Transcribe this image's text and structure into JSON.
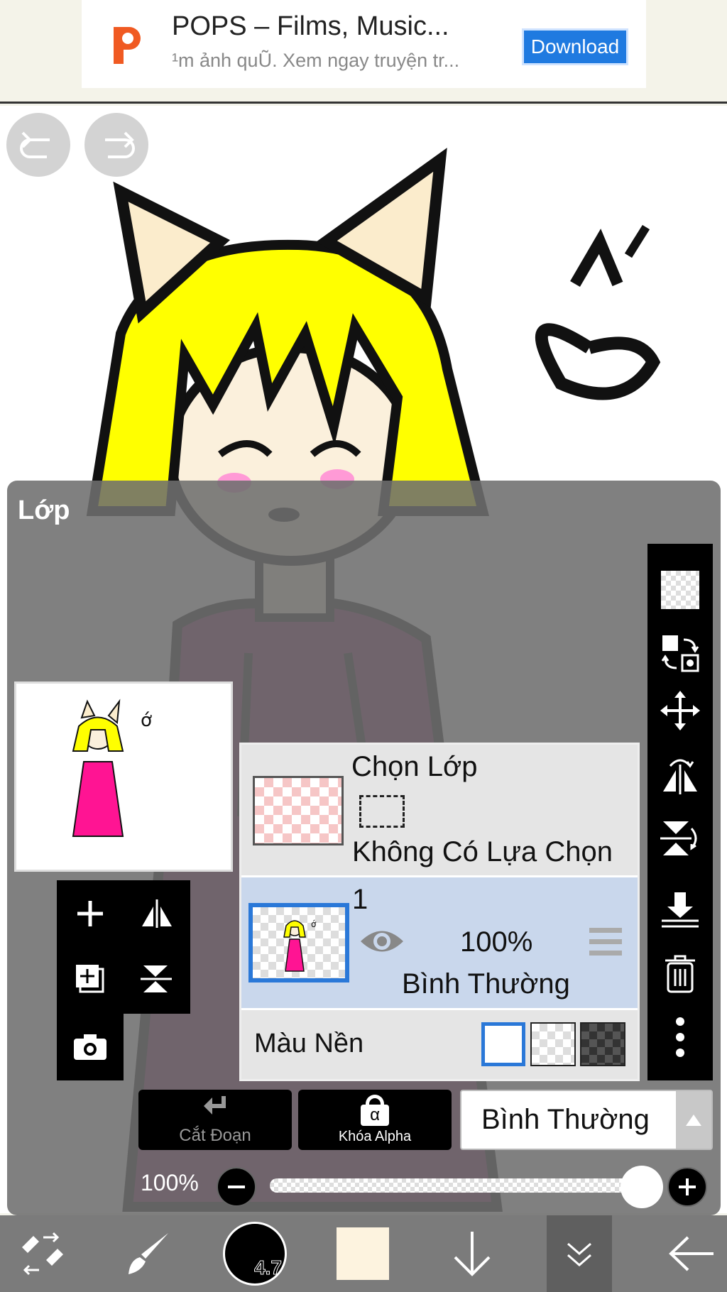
{
  "ad": {
    "title": "POPS – Films, Music...",
    "subtitle": "¹m ảnh quŨ. Xem ngay truyện tr...",
    "download_label": "Download",
    "logo_color": "#f05a22"
  },
  "canvas": {
    "undo_icon": "undo-icon",
    "redo_icon": "redo-icon"
  },
  "layer_panel": {
    "title": "Lớp",
    "selection_layer": {
      "name": "Chọn Lớp",
      "status": "Không Có Lựa Chọn"
    },
    "layers": [
      {
        "name": "1",
        "opacity": "100%",
        "blend_mode": "Bình Thường",
        "visible": true
      }
    ],
    "background": {
      "label": "Màu Nền",
      "options": [
        "white",
        "transparent",
        "dark"
      ],
      "selected": "white"
    },
    "clip_label": "Cắt Đoạn",
    "alpha_lock_label": "Khóa Alpha",
    "alpha_symbol": "α",
    "blend_mode": "Bình Thường",
    "opacity_label": "100%",
    "opacity_value": 1.0
  },
  "bottom_bar": {
    "brush_size": "4.7",
    "color": "#fdf3df"
  },
  "colors": {
    "accent_blue": "#2a78d8",
    "panel_gray": "#6e6e6e",
    "hair": "#ffff00",
    "dress": "#7a1a5c",
    "skin": "#fbf0dc"
  }
}
